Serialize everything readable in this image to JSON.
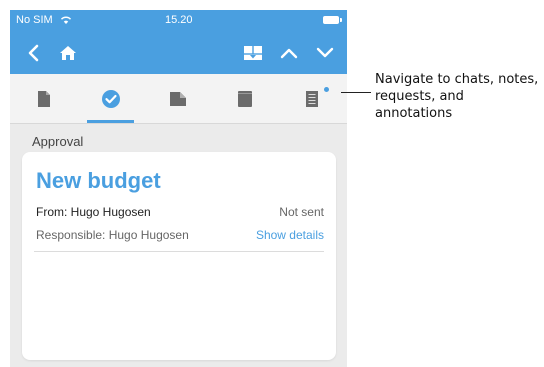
{
  "status_bar": {
    "carrier": "No SIM",
    "time": "15.20"
  },
  "navbar": {
    "icons": [
      "back-arrow-icon",
      "home-icon",
      "card-view-icon",
      "chevron-up-icon",
      "chevron-down-icon"
    ]
  },
  "tabs": [
    {
      "icon": "document-icon",
      "active": false
    },
    {
      "icon": "check-circle-icon",
      "active": true
    },
    {
      "icon": "folded-document-icon",
      "active": false
    },
    {
      "icon": "book-icon",
      "active": false
    },
    {
      "icon": "notes-icon",
      "active": false,
      "has_notification": true
    }
  ],
  "section": {
    "label": "Approval"
  },
  "card": {
    "title": "New budget",
    "from": "From: Hugo Hugosen",
    "status": "Not sent",
    "responsible": "Responsible: Hugo Hugosen",
    "show_details": "Show details"
  },
  "callout": {
    "text": "Navigate to chats, notes, requests, and annotations"
  },
  "colors": {
    "accent": "#4a9fe0",
    "background": "#ebebeb",
    "card": "#ffffff"
  }
}
